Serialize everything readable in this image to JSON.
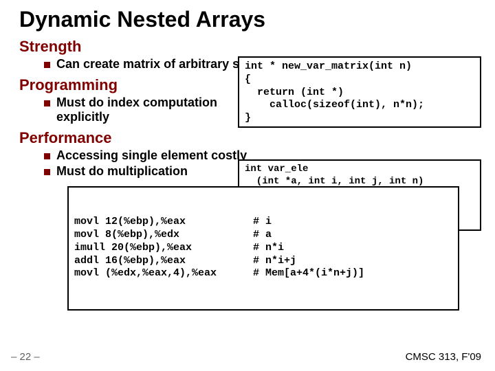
{
  "title": "Dynamic Nested Arrays",
  "sections": {
    "strength": {
      "head": "Strength",
      "items": [
        "Can create matrix of arbitrary size"
      ]
    },
    "programming": {
      "head": "Programming",
      "items": [
        "Must do index computation explicitly"
      ]
    },
    "performance": {
      "head": "Performance",
      "items": [
        "Accessing single element costly",
        "Must do multiplication"
      ]
    }
  },
  "code": {
    "new_var_matrix": "int * new_var_matrix(int n)\n{\n  return (int *)\n    calloc(sizeof(int), n*n);\n}",
    "var_ele": "int var_ele\n  (int *a, int i, int j, int n)\n{\n  return a[i*n + j];\n}",
    "asm": {
      "rows": [
        {
          "instr": "movl 12(%ebp),%eax",
          "comment": "# i"
        },
        {
          "instr": "movl 8(%ebp),%edx",
          "comment": "# a"
        },
        {
          "instr": "imull 20(%ebp),%eax",
          "comment": "# n*i"
        },
        {
          "instr": "addl 16(%ebp),%eax",
          "comment": "# n*i+j"
        },
        {
          "instr": "movl (%edx,%eax,4),%eax",
          "comment": "# Mem[a+4*(i*n+j)]"
        }
      ]
    }
  },
  "footer": {
    "left": "– 22 –",
    "right": "CMSC 313, F'09"
  }
}
